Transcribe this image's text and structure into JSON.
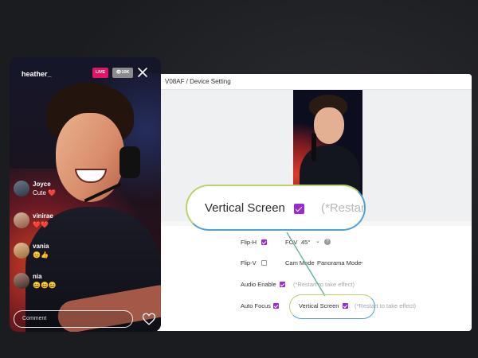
{
  "settings_window": {
    "title": "V08AF / Device Setting",
    "rows": {
      "flip_h": {
        "label": "Flip-H",
        "checked": true
      },
      "flip_v": {
        "label": "Flip-V",
        "checked": false
      },
      "audio_enable": {
        "label": "Audio Enable",
        "checked": true,
        "hint": "(*Restart to take effect)"
      },
      "auto_focus": {
        "label": "Auto Focus",
        "checked": true
      },
      "fov": {
        "label": "FOV",
        "value": "45°"
      },
      "cam_mode": {
        "label": "Cam Mode",
        "value": "Panorama Mode"
      },
      "vertical_screen": {
        "label": "Vertical Screen",
        "checked": true,
        "hint": "(*Restart to take effect)"
      }
    }
  },
  "zoom_callout": {
    "label": "Vertical Screen",
    "hint": "(*Restar"
  },
  "live_stream": {
    "streamer": "heather_",
    "live_badge": "LIVE",
    "viewer_count": "10K",
    "comment_placeholder": "Comment",
    "chat": [
      {
        "user": "Joyce",
        "message": "Cute ❤️"
      },
      {
        "user": "vinirae",
        "message": "❤️❤️"
      },
      {
        "user": "vania",
        "message": "😊👍"
      },
      {
        "user": "nia",
        "message": "😄😄😄"
      }
    ]
  },
  "icons": {
    "close": "close-icon",
    "heart": "heart-icon",
    "eye": "eye-icon",
    "help": "help-icon",
    "caret": "chevron-down-icon"
  },
  "colors": {
    "accent_purple": "#9b2ad3",
    "live_pink": "#e0156a",
    "callout_green": "#b9d26b",
    "callout_blue": "#4fa1d8"
  }
}
